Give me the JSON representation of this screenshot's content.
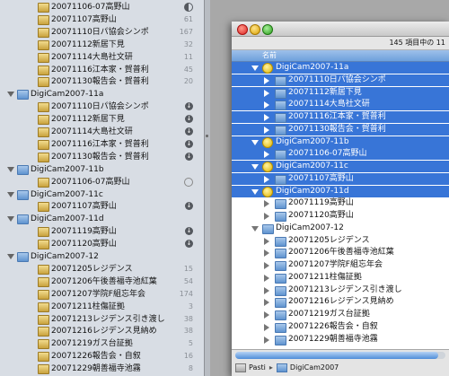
{
  "sidebar": {
    "items": [
      {
        "label": "20071106-07高野山",
        "depth": 2,
        "icon": "album-icon",
        "badge": "",
        "status": "half"
      },
      {
        "label": "20071107高野山",
        "depth": 2,
        "icon": "album-icon",
        "badge": "61",
        "status": ""
      },
      {
        "label": "20071110日パ協会シンポ",
        "depth": 2,
        "icon": "album-icon",
        "badge": "167",
        "status": ""
      },
      {
        "label": "20071112新居下見",
        "depth": 2,
        "icon": "album-icon",
        "badge": "32",
        "status": ""
      },
      {
        "label": "20071114大島社文研",
        "depth": 2,
        "icon": "album-icon",
        "badge": "11",
        "status": ""
      },
      {
        "label": "20071116江本家・賀普利",
        "depth": 2,
        "icon": "album-icon",
        "badge": "45",
        "status": ""
      },
      {
        "label": "20071130報告会・賀普利",
        "depth": 2,
        "icon": "album-icon",
        "badge": "20",
        "status": ""
      },
      {
        "label": "DigiCam2007-11a",
        "depth": 1,
        "icon": "folder-icon",
        "badge": "",
        "status": "",
        "expanded": true
      },
      {
        "label": "20071110日パ協会シンポ",
        "depth": 2,
        "icon": "album-icon",
        "badge": "",
        "status": "down"
      },
      {
        "label": "20071112新居下見",
        "depth": 2,
        "icon": "album-icon",
        "badge": "",
        "status": "down"
      },
      {
        "label": "20071114大島社文研",
        "depth": 2,
        "icon": "album-icon",
        "badge": "",
        "status": "down"
      },
      {
        "label": "20071116江本家・賀普利",
        "depth": 2,
        "icon": "album-icon",
        "badge": "",
        "status": "down"
      },
      {
        "label": "20071130報告会・賀普利",
        "depth": 2,
        "icon": "album-icon",
        "badge": "",
        "status": "down"
      },
      {
        "label": "DigiCam2007-11b",
        "depth": 1,
        "icon": "folder-icon",
        "badge": "",
        "status": "",
        "expanded": true
      },
      {
        "label": "20071106-07高野山",
        "depth": 2,
        "icon": "album-icon",
        "badge": "",
        "status": "empty"
      },
      {
        "label": "DigiCam2007-11c",
        "depth": 1,
        "icon": "folder-icon",
        "badge": "",
        "status": "",
        "expanded": true
      },
      {
        "label": "20071107高野山",
        "depth": 2,
        "icon": "album-icon",
        "badge": "",
        "status": "down"
      },
      {
        "label": "DigiCam2007-11d",
        "depth": 1,
        "icon": "folder-icon",
        "badge": "",
        "status": "",
        "expanded": true
      },
      {
        "label": "20071119高野山",
        "depth": 2,
        "icon": "album-icon",
        "badge": "",
        "status": "down"
      },
      {
        "label": "20071120高野山",
        "depth": 2,
        "icon": "album-icon",
        "badge": "",
        "status": "down"
      },
      {
        "label": "DigiCam2007-12",
        "depth": 1,
        "icon": "folder-icon",
        "badge": "",
        "status": "",
        "expanded": true
      },
      {
        "label": "20071205レジデンス",
        "depth": 2,
        "icon": "album-icon",
        "badge": "15",
        "status": ""
      },
      {
        "label": "20071206午後善福寺池紅葉",
        "depth": 2,
        "icon": "album-icon",
        "badge": "54",
        "status": ""
      },
      {
        "label": "20071207学院F組忘年会",
        "depth": 2,
        "icon": "album-icon",
        "badge": "174",
        "status": ""
      },
      {
        "label": "20071211柱傷証拠",
        "depth": 2,
        "icon": "album-icon",
        "badge": "3",
        "status": ""
      },
      {
        "label": "20071213レジデンス引き渡し",
        "depth": 2,
        "icon": "album-icon",
        "badge": "38",
        "status": ""
      },
      {
        "label": "20071216レジデンス見納め",
        "depth": 2,
        "icon": "album-icon",
        "badge": "38",
        "status": ""
      },
      {
        "label": "20071219ガス台証拠",
        "depth": 2,
        "icon": "album-icon",
        "badge": "5",
        "status": ""
      },
      {
        "label": "20071226報告会・自叙",
        "depth": 2,
        "icon": "album-icon",
        "badge": "16",
        "status": ""
      },
      {
        "label": "20071229朝善福寺池霧",
        "depth": 2,
        "icon": "album-icon",
        "badge": "8",
        "status": ""
      }
    ]
  },
  "window": {
    "status_text": "145 項目中の 11",
    "column_header": "名前",
    "rows": [
      {
        "label": "DigiCam2007-11a",
        "depth": 0,
        "kind": "root",
        "tri": "down",
        "selected": true
      },
      {
        "label": "20071110日パ協会シンポ",
        "depth": 1,
        "kind": "folder",
        "tri": "right",
        "selected": true
      },
      {
        "label": "20071112新居下見",
        "depth": 1,
        "kind": "folder",
        "tri": "right",
        "selected": true
      },
      {
        "label": "20071114大島社文研",
        "depth": 1,
        "kind": "folder",
        "tri": "right",
        "selected": true
      },
      {
        "label": "20071116江本家・賀普利",
        "depth": 1,
        "kind": "folder",
        "tri": "right",
        "selected": true
      },
      {
        "label": "20071130報告会・賀普利",
        "depth": 1,
        "kind": "folder",
        "tri": "right",
        "selected": true
      },
      {
        "label": "DigiCam2007-11b",
        "depth": 0,
        "kind": "root",
        "tri": "down",
        "selected": true
      },
      {
        "label": "20071106-07高野山",
        "depth": 1,
        "kind": "folder",
        "tri": "right",
        "selected": true
      },
      {
        "label": "DigiCam2007-11c",
        "depth": 0,
        "kind": "root",
        "tri": "down",
        "selected": true
      },
      {
        "label": "20071107高野山",
        "depth": 1,
        "kind": "folder",
        "tri": "right",
        "selected": true
      },
      {
        "label": "DigiCam2007-11d",
        "depth": 0,
        "kind": "root",
        "tri": "down",
        "selected": true
      },
      {
        "label": "20071119高野山",
        "depth": 1,
        "kind": "folder",
        "tri": "right",
        "selected": false
      },
      {
        "label": "20071120高野山",
        "depth": 1,
        "kind": "folder",
        "tri": "right",
        "selected": false
      },
      {
        "label": "DigiCam2007-12",
        "depth": 0,
        "kind": "folder",
        "tri": "down",
        "selected": false
      },
      {
        "label": "20071205レジデンス",
        "depth": 1,
        "kind": "folder",
        "tri": "right",
        "selected": false
      },
      {
        "label": "20071206午後善福寺池紅葉",
        "depth": 1,
        "kind": "folder",
        "tri": "right",
        "selected": false
      },
      {
        "label": "20071207学院F組忘年会",
        "depth": 1,
        "kind": "folder",
        "tri": "right",
        "selected": false
      },
      {
        "label": "20071211柱傷証拠",
        "depth": 1,
        "kind": "folder",
        "tri": "right",
        "selected": false
      },
      {
        "label": "20071213レジデンス引き渡し",
        "depth": 1,
        "kind": "folder",
        "tri": "right",
        "selected": false
      },
      {
        "label": "20071216レジデンス見納め",
        "depth": 1,
        "kind": "folder",
        "tri": "right",
        "selected": false
      },
      {
        "label": "20071219ガス台証拠",
        "depth": 1,
        "kind": "folder",
        "tri": "right",
        "selected": false
      },
      {
        "label": "20071226報告会・自叙",
        "depth": 1,
        "kind": "folder",
        "tri": "right",
        "selected": false
      },
      {
        "label": "20071229朝善福寺池霧",
        "depth": 1,
        "kind": "folder",
        "tri": "right",
        "selected": false
      }
    ],
    "path": [
      "Pasti",
      "DigiCam2007"
    ]
  },
  "colors": {
    "selection": "#3875d7",
    "sidebar_bg": "#d8dde4"
  }
}
